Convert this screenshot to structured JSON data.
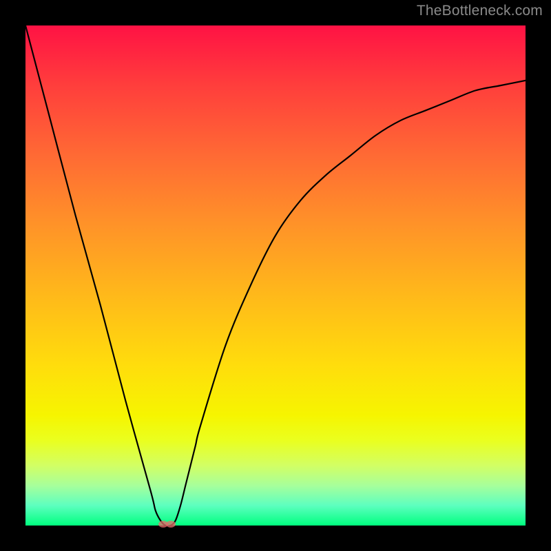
{
  "watermark": "TheBottleneck.com",
  "chart_data": {
    "type": "line",
    "title": "",
    "xlabel": "",
    "ylabel": "",
    "xlim": [
      0,
      100
    ],
    "ylim": [
      0,
      100
    ],
    "grid": false,
    "legend": false,
    "series": [
      {
        "name": "bottleneck-curve",
        "x": [
          0,
          5,
          10,
          15,
          20,
          25,
          26,
          27,
          28,
          29,
          30,
          31,
          32,
          33,
          34,
          35,
          40,
          45,
          50,
          55,
          60,
          65,
          70,
          75,
          80,
          85,
          90,
          95,
          100
        ],
        "y": [
          100,
          81,
          62,
          44,
          25,
          7,
          3,
          1,
          0,
          0,
          1,
          4,
          8,
          12,
          16,
          20,
          36,
          48,
          58,
          65,
          70,
          74,
          78,
          81,
          83,
          85,
          87,
          88,
          89
        ]
      }
    ],
    "markers": [
      {
        "name": "point-a",
        "x": 27.5,
        "y": 0.3
      },
      {
        "name": "point-b",
        "x": 29.0,
        "y": 0.3
      }
    ],
    "gradient_description": "vertical red-to-green, red at top (high bottleneck) to green at bottom (no bottleneck)"
  }
}
